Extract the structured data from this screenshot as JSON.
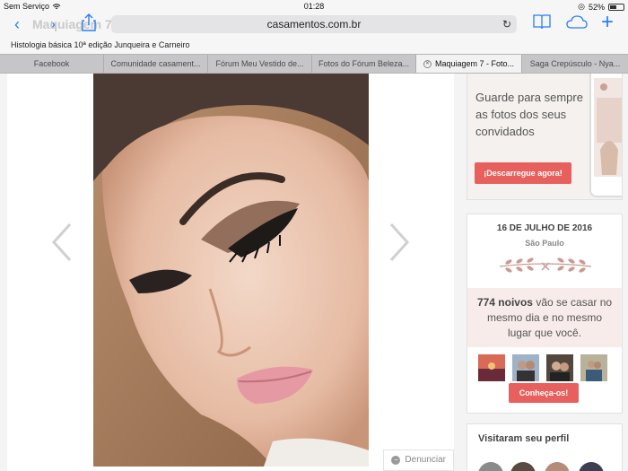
{
  "status": {
    "carrier": "Sem Serviço",
    "time": "01:28",
    "battery": "52%",
    "battery_level": 0.52
  },
  "toolbar": {
    "ghost_title": "Maquiagem 7",
    "url": "casamentos.com.br"
  },
  "bookmarks": {
    "item": "Histologia básica 10ª edição Junqueira e Carneiro"
  },
  "tabs": [
    {
      "label": "Facebook"
    },
    {
      "label": "Comunidade casament..."
    },
    {
      "label": "Fórum Meu Vestido de..."
    },
    {
      "label": "Fotos do Fórum Beleza..."
    },
    {
      "label": "Maquiagem 7 - Foto...",
      "active": true
    },
    {
      "label": "Saga Crepúsculo - Nya..."
    }
  ],
  "gallery": {
    "report_label": "Denunciar"
  },
  "promo": {
    "text": "Guarde para sempre as fotos dos seus convidados",
    "button": "¡Descarregue agora!"
  },
  "wedding": {
    "date": "16 DE JULHO DE 2016",
    "city": "São Paulo",
    "count": "774 noivos",
    "text": "vão se casar no mesmo dia e no mesmo lugar que você.",
    "button": "Conheça-os!"
  },
  "visited": {
    "title": "Visitaram seu perfil"
  },
  "colors": {
    "accent": "#2a7ef7",
    "brand": "#e8605d"
  },
  "icons": [
    "wifi-icon",
    "back-icon",
    "forward-icon",
    "share-icon",
    "reload-icon",
    "bookmarks-icon",
    "cloud-icon",
    "add-tab-icon",
    "tab-close-icon",
    "chevron-left-icon",
    "chevron-right-icon",
    "report-icon",
    "laurel-icon"
  ]
}
